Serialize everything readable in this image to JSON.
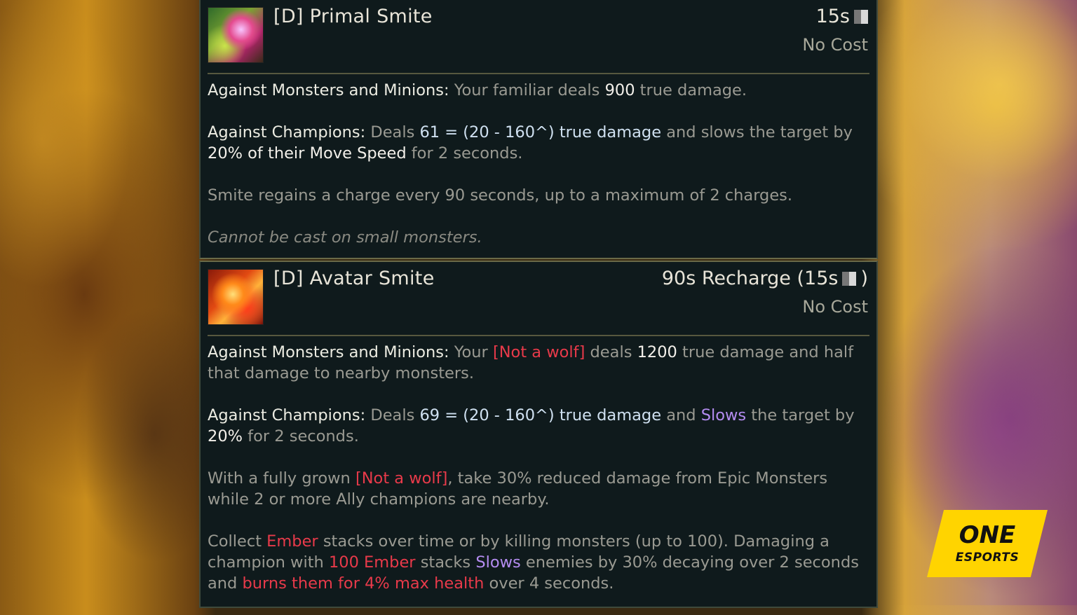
{
  "primal": {
    "title": "[D] Primal Smite",
    "cooldown": "15s",
    "cost": "No Cost",
    "p1_label": "Against Monsters and Minions:",
    "p1_a": " Your familiar deals ",
    "p1_val": "900",
    "p1_b": " true damage.",
    "p2_label": "Against Champions:",
    "p2_a": " Deals ",
    "p2_val": "61",
    "p2_formula": " = (20 - 160",
    "p2_close": ") true damage",
    "p2_b": " and slows the target by ",
    "p2_slow": "20% of their Move Speed",
    "p2_c": " for 2 seconds.",
    "p3": "Smite regains a charge every 90 seconds, up to a maximum of 2 charges.",
    "p4": "Cannot be cast on small monsters."
  },
  "avatar": {
    "title": "[D] Avatar Smite",
    "cooldown": "90s Recharge (15s",
    "cooldown_close": ")",
    "cost": "No Cost",
    "p1_label": "Against Monsters and Minions:",
    "p1_a": " Your ",
    "p1_wolf": "[Not a wolf]",
    "p1_b": " deals ",
    "p1_val": "1200",
    "p1_c": " true damage and half that damage to nearby monsters.",
    "p2_label": "Against Champions:",
    "p2_a": " Deals ",
    "p2_val": "69",
    "p2_formula": " = (20 - 160",
    "p2_close": ") true damage",
    "p2_b": " and ",
    "p2_slows": "Slows",
    "p2_c": " the target by ",
    "p2_pct": "20%",
    "p2_d": " for 2 seconds.",
    "p3_a": "With a fully grown ",
    "p3_wolf": "[Not a wolf]",
    "p3_b": ", take 30% reduced damage from Epic Monsters while 2 or more Ally champions are nearby.",
    "p4_a": "Collect ",
    "p4_ember": "Ember",
    "p4_b": " stacks over time or by killing monsters (up to 100). Damaging a champion with ",
    "p4_ember100": "100 Ember",
    "p4_c": " stacks ",
    "p4_slows": "Slows",
    "p4_d": " enemies by 30% decaying over 2 seconds and ",
    "p4_burn": "burns them for 4% max health",
    "p4_e": " over 4 seconds."
  },
  "level_icon": "^",
  "badge": {
    "top": "ONE",
    "bottom": "ESPORTS"
  },
  "colors": {
    "highlight_red": "#e83a4a",
    "highlight_purple": "#b48cf0",
    "badge_yellow": "#ffd400"
  }
}
